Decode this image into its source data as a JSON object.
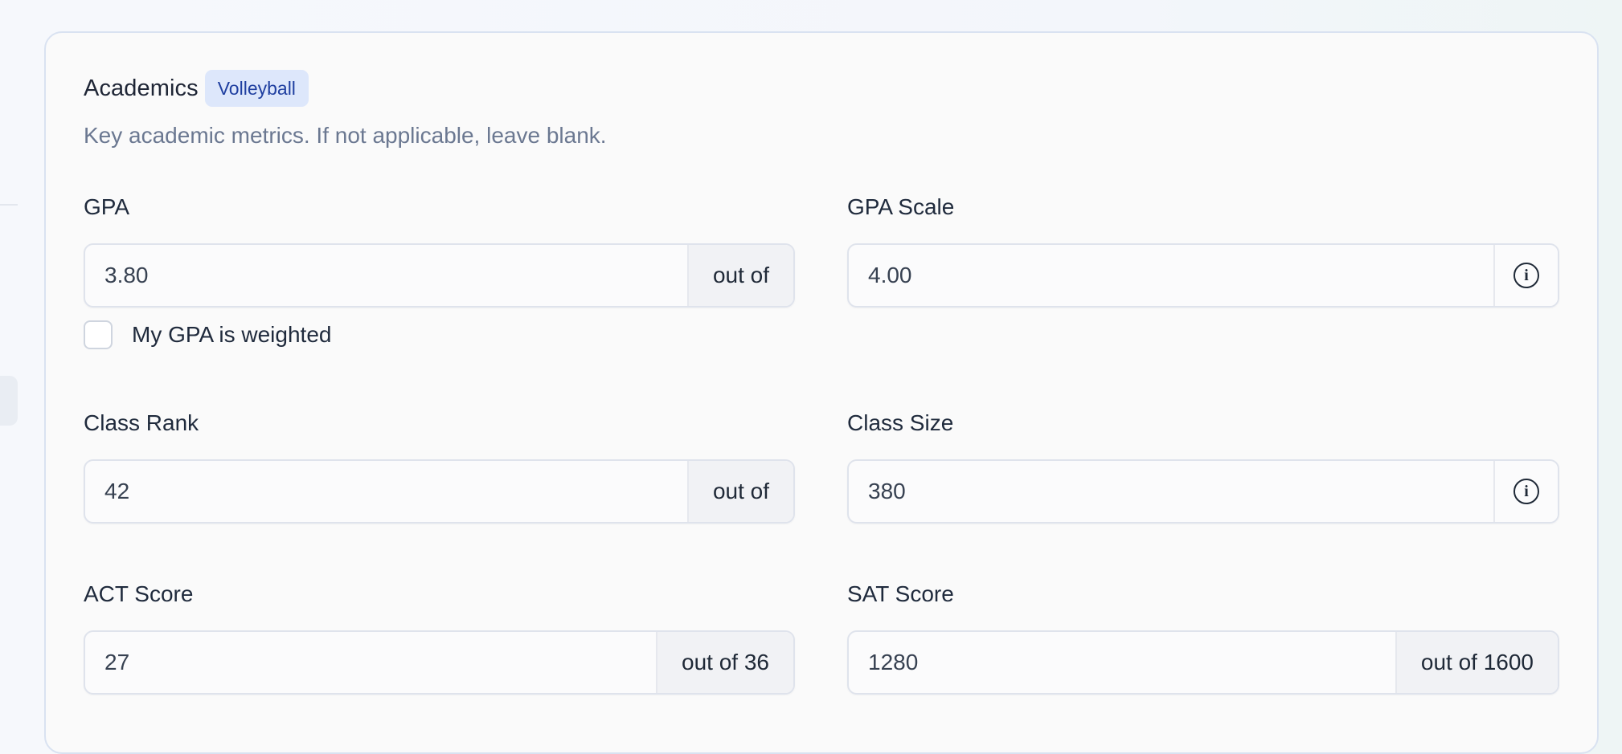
{
  "section": {
    "title": "Academics",
    "badge": "Volleyball",
    "description": "Key academic metrics. If not applicable, leave blank."
  },
  "fields": {
    "gpa": {
      "label": "GPA",
      "value": "3.80",
      "suffix": "out of"
    },
    "gpa_weighted": {
      "label": "My GPA is weighted",
      "checked": false
    },
    "gpa_scale": {
      "label": "GPA Scale",
      "value": "4.00",
      "icon": "info-icon"
    },
    "class_rank": {
      "label": "Class Rank",
      "value": "42",
      "suffix": "out of"
    },
    "class_size": {
      "label": "Class Size",
      "value": "380",
      "icon": "info-icon"
    },
    "act_score": {
      "label": "ACT Score",
      "value": "27",
      "suffix": "out of 36"
    },
    "sat_score": {
      "label": "SAT Score",
      "value": "1280",
      "suffix": "out of 1600"
    }
  }
}
